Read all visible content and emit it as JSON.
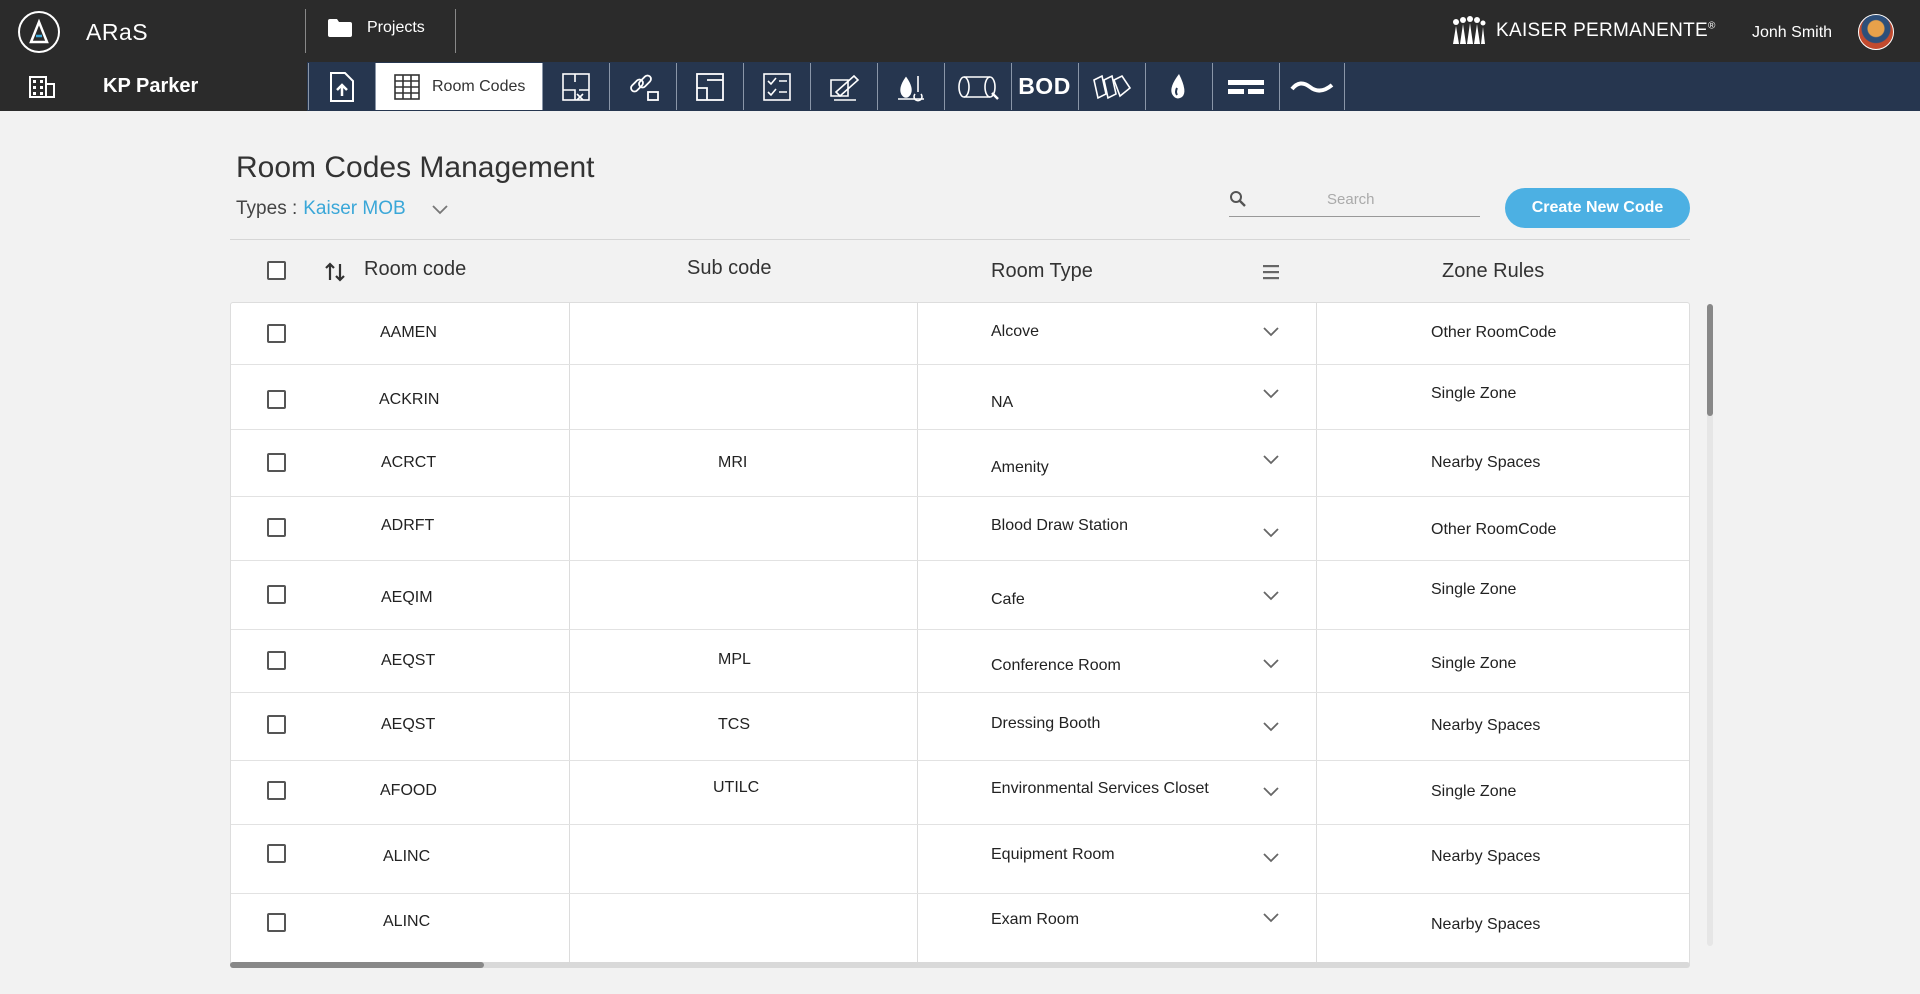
{
  "app": {
    "name": "ARaS"
  },
  "topbar": {
    "projects_label": "Projects",
    "brand_text": "KAISER PERMANENTE",
    "brand_mark": "®",
    "user_name": "Jonh Smith"
  },
  "navbar": {
    "project_name": "KP Parker",
    "active_tab_label": "Room Codes",
    "tools": [
      {
        "name": "upload-document-icon"
      },
      {
        "name": "room-codes-grid-icon"
      },
      {
        "name": "floor-plan-icon"
      },
      {
        "name": "link-excel-icon"
      },
      {
        "name": "layout-icon"
      },
      {
        "name": "checklist-icon"
      },
      {
        "name": "edit-drawing-icon"
      },
      {
        "name": "temperature-drop-icon"
      },
      {
        "name": "pipe-icon"
      },
      {
        "name": "bod-icon",
        "text": "BOD"
      },
      {
        "name": "materials-icon"
      },
      {
        "name": "water-drop-icon"
      },
      {
        "name": "double-line-icon"
      },
      {
        "name": "wave-icon"
      }
    ]
  },
  "page": {
    "title": "Room Codes Management",
    "types_label": "Types :",
    "types_value": "Kaiser MOB",
    "search_placeholder": "Search",
    "create_button": "Create New Code"
  },
  "table": {
    "headers": {
      "room_code": "Room code",
      "sub_code": "Sub code",
      "room_type": "Room Type",
      "zone_rules": "Zone Rules"
    },
    "rows": [
      {
        "room_code": "AAMEN",
        "sub_code": "",
        "room_type": "Alcove",
        "zone_rule": "Other RoomCode"
      },
      {
        "room_code": "ACKRIN",
        "sub_code": "",
        "room_type": "NA",
        "zone_rule": "Single Zone"
      },
      {
        "room_code": "ACRCT",
        "sub_code": "MRI",
        "room_type": "Amenity",
        "zone_rule": "Nearby Spaces"
      },
      {
        "room_code": "ADRFT",
        "sub_code": "",
        "room_type": "Blood Draw Station",
        "zone_rule": "Other RoomCode"
      },
      {
        "room_code": "AEQIM",
        "sub_code": "",
        "room_type": "Cafe",
        "zone_rule": "Single Zone"
      },
      {
        "room_code": "AEQST",
        "sub_code": "MPL",
        "room_type": "Conference Room",
        "zone_rule": "Single Zone"
      },
      {
        "room_code": "AEQST",
        "sub_code": "TCS",
        "room_type": "Dressing Booth",
        "zone_rule": "Nearby Spaces"
      },
      {
        "room_code": "AFOOD",
        "sub_code": "UTILC",
        "room_type": "Environmental Services Closet",
        "zone_rule": "Single Zone"
      },
      {
        "room_code": "ALINC",
        "sub_code": "",
        "room_type": "Equipment Room",
        "zone_rule": "Nearby Spaces"
      },
      {
        "room_code": "ALINC",
        "sub_code": "",
        "room_type": "Exam Room",
        "zone_rule": "Nearby Spaces"
      }
    ]
  },
  "colors": {
    "topbar": "#2b2b2b",
    "navbar": "#26364f",
    "accent": "#4cb0e3",
    "link": "#3aa7d8"
  }
}
